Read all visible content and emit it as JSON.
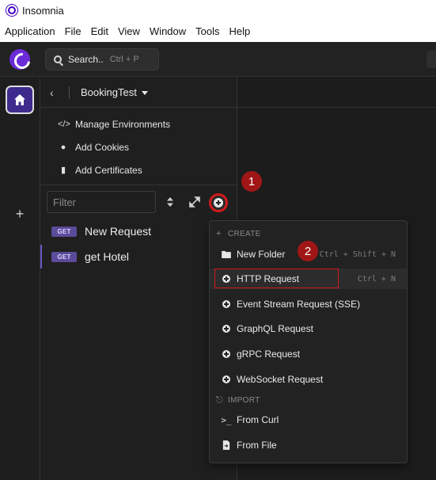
{
  "window": {
    "title": "Insomnia"
  },
  "menubar": {
    "items": [
      "Application",
      "File",
      "Edit",
      "View",
      "Window",
      "Tools",
      "Help"
    ]
  },
  "header": {
    "search_label": "Search..",
    "search_shortcut": "Ctrl + P"
  },
  "project": {
    "name": "BookingTest"
  },
  "sidebar": {
    "links": [
      {
        "icon": "code-icon",
        "label": "Manage Environments"
      },
      {
        "icon": "cookie-icon",
        "label": "Add Cookies"
      },
      {
        "icon": "certificate-icon",
        "label": "Add Certificates"
      }
    ],
    "filter_placeholder": "Filter",
    "requests": [
      {
        "method": "GET",
        "name": "New Request",
        "active": false
      },
      {
        "method": "GET",
        "name": "get Hotel",
        "active": true
      }
    ]
  },
  "steps": {
    "one": "1",
    "two": "2"
  },
  "dropdown": {
    "create_heading": "CREATE",
    "new_folder": {
      "label": "New Folder",
      "shortcut": "Ctrl + Shift + N"
    },
    "http_request": {
      "label": "HTTP Request",
      "shortcut": "Ctrl + N"
    },
    "event_stream": {
      "label": "Event Stream Request (SSE)"
    },
    "graphql": {
      "label": "GraphQL Request"
    },
    "grpc": {
      "label": "gRPC Request"
    },
    "websocket": {
      "label": "WebSocket Request"
    },
    "import_heading": "IMPORT",
    "from_curl": {
      "label": "From Curl"
    },
    "from_file": {
      "label": "From File"
    }
  },
  "colors": {
    "accent": "#6c2bd9",
    "method_badge": "#5b4b9a",
    "highlight_red": "#d11a1a",
    "step_badge": "#a01616"
  }
}
